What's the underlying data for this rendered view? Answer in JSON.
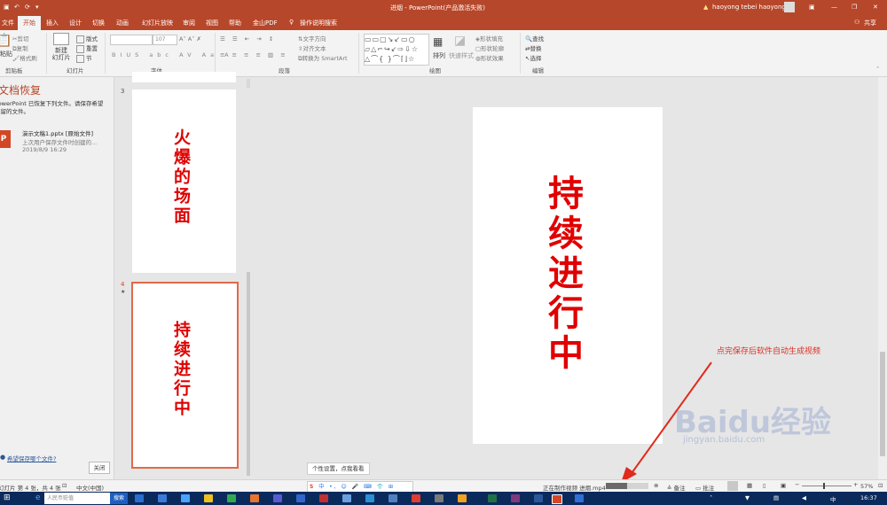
{
  "titlebar": {
    "title": "进烟 - PowerPoint(产品激活失败)",
    "user": "haoyong tebei haoyong",
    "warning_icon": "warning-icon",
    "share": "共享"
  },
  "tabs": [
    "文件",
    "开始",
    "插入",
    "设计",
    "切换",
    "动画",
    "幻灯片放映",
    "审阅",
    "视图",
    "帮助",
    "金山PDF",
    "操作说明搜索"
  ],
  "active_tab": "开始",
  "ribbon": {
    "clipboard": {
      "label": "剪贴板",
      "paste": "粘贴",
      "cut": "剪切",
      "copy": "复制",
      "format_painter": "格式刷"
    },
    "slides": {
      "label": "幻灯片",
      "new_slide": "新建\n幻灯片",
      "layout": "版式",
      "reset": "重置",
      "section": "节"
    },
    "font": {
      "label": "字体",
      "size": "107"
    },
    "paragraph": {
      "label": "段落",
      "text_direction": "文字方向",
      "align_text": "对齐文本",
      "smartart": "转换为 SmartArt"
    },
    "drawing": {
      "label": "绘图",
      "arrange": "排列",
      "quick_styles": "快速样式",
      "shape_fill": "形状填充",
      "shape_outline": "形状轮廓",
      "shape_effects": "形状效果"
    },
    "editing": {
      "label": "编辑",
      "find": "查找",
      "replace": "替换",
      "select": "选择"
    }
  },
  "recovery": {
    "title": "文档恢复",
    "message": "PowerPoint 已恢复下列文件。请保存希望保留的文件。",
    "file_name": "演示文稿1.pptx  [原始文件]",
    "file_desc": "上次用户保存文件时创建的...",
    "file_date": "2019/8/9 16:29",
    "help_link": "希望保存哪个文件?",
    "close": "关闭"
  },
  "thumbnails": [
    {
      "number": "3",
      "text": "火爆的场面"
    },
    {
      "number": "4",
      "text": "持续进行中",
      "star": "★"
    }
  ],
  "main_slide": {
    "text": "持续进行中"
  },
  "annotation": "点完保存后软件自动生成视频",
  "ime_tooltip": "个性设置，点我看看",
  "statusbar": {
    "slide_info": "幻灯片 第 4 张，共 4 张",
    "language": "中文(中国)",
    "progress_text": "正在制作视频 进烟.mp4",
    "progress": 0.5,
    "notes": "备注",
    "comments": "批注",
    "zoom": "57%"
  },
  "taskbar": {
    "search_placeholder": "人民币贬值",
    "search_button": "搜索",
    "time": "16:37"
  },
  "watermark": {
    "brand": "Baidu经验",
    "url": "jingyan.baidu.com"
  },
  "colors": {
    "accent": "#b7472a",
    "red_text": "#e00000",
    "annotation": "#d93025",
    "taskbar": "#0b2a5c"
  }
}
